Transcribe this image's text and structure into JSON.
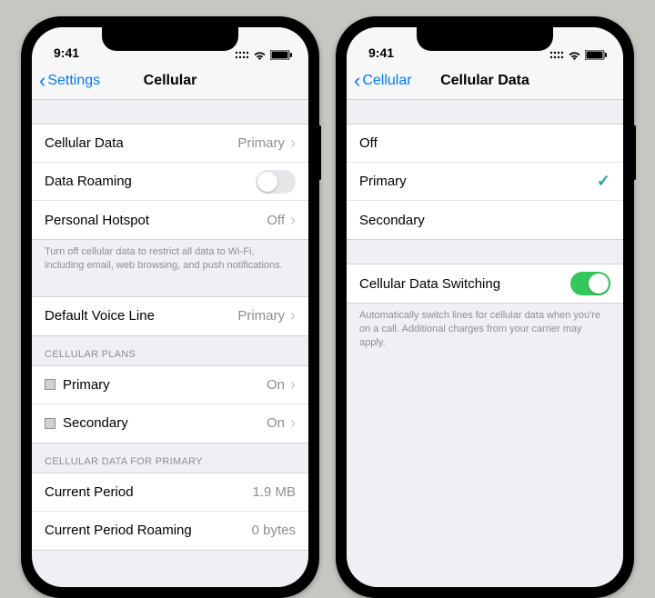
{
  "status": {
    "time": "9:41"
  },
  "left": {
    "back_label": "Settings",
    "title": "Cellular",
    "rows": {
      "cellular_data": {
        "label": "Cellular Data",
        "value": "Primary"
      },
      "data_roaming": {
        "label": "Data Roaming"
      },
      "hotspot": {
        "label": "Personal Hotspot",
        "value": "Off"
      }
    },
    "cellular_footer": "Turn off cellular data to restrict all data to Wi-Fi, including email, web browsing, and push notifications.",
    "voice_line": {
      "label": "Default Voice Line",
      "value": "Primary"
    },
    "plans_header": "CELLULAR PLANS",
    "plans": [
      {
        "label": "Primary",
        "value": "On"
      },
      {
        "label": "Secondary",
        "value": "On"
      }
    ],
    "data_header": "CELLULAR DATA FOR PRIMARY",
    "usage": {
      "period": {
        "label": "Current Period",
        "value": "1.9 MB"
      },
      "period_roaming": {
        "label": "Current Period Roaming",
        "value": "0 bytes"
      }
    }
  },
  "right": {
    "back_label": "Cellular",
    "title": "Cellular Data",
    "options": [
      {
        "label": "Off",
        "selected": false
      },
      {
        "label": "Primary",
        "selected": true
      },
      {
        "label": "Secondary",
        "selected": false
      }
    ],
    "switching": {
      "label": "Cellular Data Switching",
      "on": true
    },
    "switching_footer": "Automatically switch lines for cellular data when you're on a call. Additional charges from your carrier may apply."
  }
}
